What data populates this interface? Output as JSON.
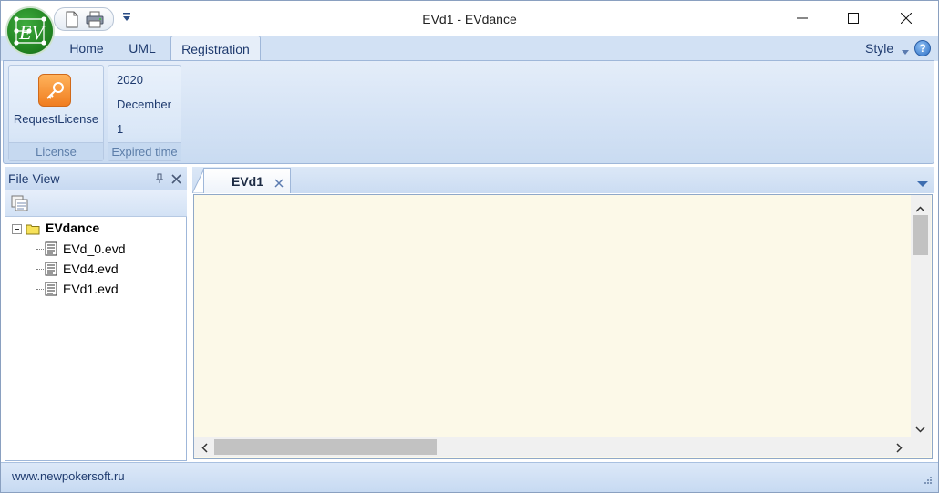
{
  "window": {
    "title": "EVd1 - EVdance",
    "logo_text": "EV"
  },
  "ribbon": {
    "tabs": [
      {
        "label": "Home",
        "active": false
      },
      {
        "label": "UML",
        "active": false
      },
      {
        "label": "Registration",
        "active": true
      }
    ],
    "style_label": "Style",
    "help_label": "?",
    "groups": {
      "license": {
        "caption": "License",
        "button_label": "RequestLicense",
        "icon": "key-icon"
      },
      "expired": {
        "caption": "Expired time",
        "year": "2020",
        "month": "December",
        "day": "1"
      }
    }
  },
  "file_view": {
    "title": "File View",
    "root": "EVdance",
    "files": [
      "EVd_0.evd",
      "EVd4.evd",
      "EVd1.evd"
    ]
  },
  "document": {
    "tabs": [
      {
        "label": "EVd1",
        "active": true
      }
    ]
  },
  "status": {
    "text": "www.newpokersoft.ru"
  },
  "colors": {
    "ribbon_bg": "#d2e1f4",
    "editor_bg": "#fcf9e8",
    "accent_text": "#1e3a6e",
    "license_icon": "#f07d1f",
    "logo_green": "#1f7f1f"
  }
}
